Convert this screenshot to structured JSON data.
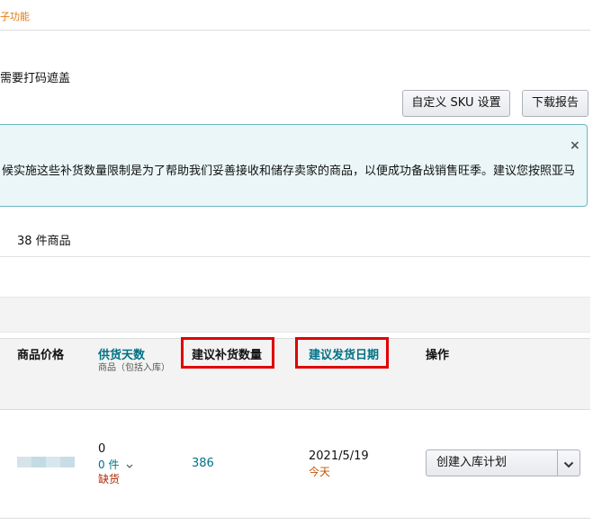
{
  "top": {
    "link_label": "子功能"
  },
  "mask_notice": "需要打码遮盖",
  "toolbar": {
    "sku_button": "自定义 SKU 设置",
    "download_button": "下载报告"
  },
  "alert": {
    "text": "候实施这些补货数量限制是为了帮助我们妥善接收和储存卖家的商品，以便成功备战销售旺季。建议您按照亚马",
    "close": "×"
  },
  "result_count": "38 件商品",
  "table": {
    "headers": {
      "price": "商品价格",
      "days": "供货天数",
      "days_sub": "商品（包括入库）",
      "qty": "建议补货数量",
      "date": "建议发货日期",
      "action": "操作"
    },
    "rows": [
      {
        "days_value": "0",
        "days_units": "0 件",
        "days_stock": "缺货",
        "qty": "386",
        "date": "2021/5/19",
        "date_sub": "今天",
        "action_label": "创建入库计划"
      }
    ]
  },
  "colors": {
    "accent_link": "#007185",
    "highlight": "#e00000",
    "alert_bg": "#eaf6f7",
    "out_of_stock": "#b12704",
    "today": "#c45500"
  }
}
